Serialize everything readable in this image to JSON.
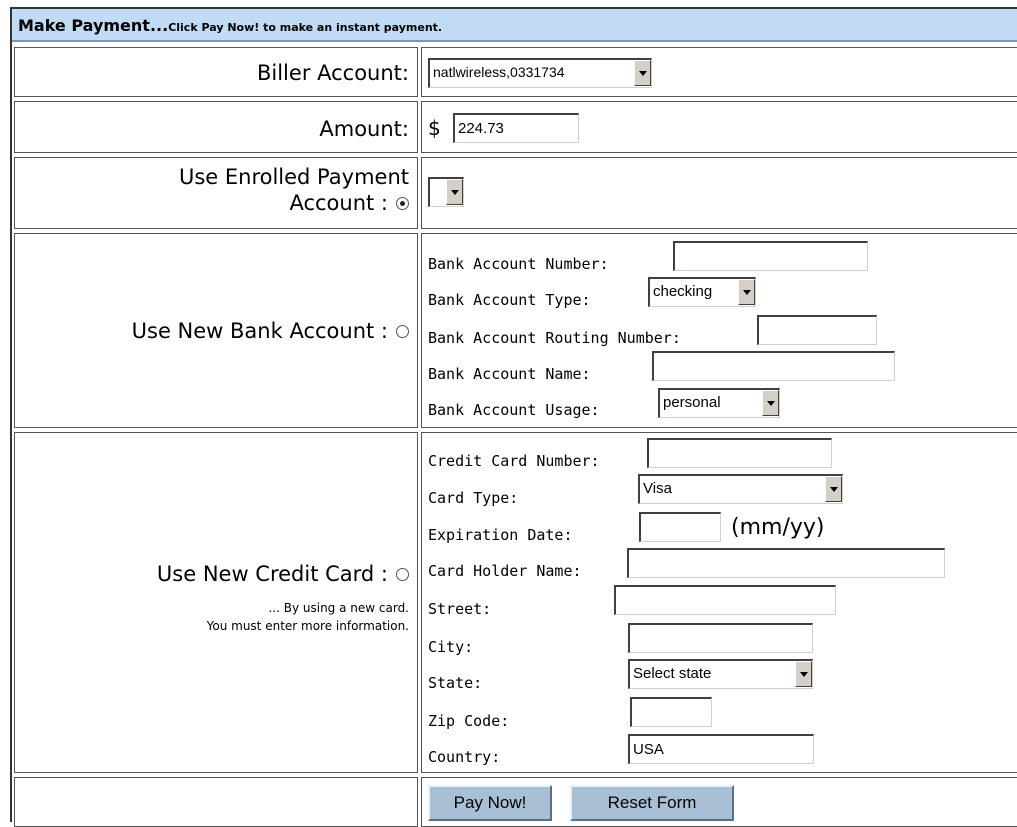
{
  "header": {
    "title": "Make Payment...",
    "subtitle": "Click Pay Now! to make an instant payment."
  },
  "biller": {
    "label": "Biller Account:",
    "value": "natlwireless,0331734"
  },
  "amount": {
    "label": "Amount:",
    "currency": "$",
    "value": "224.73"
  },
  "enrolled": {
    "label_line1": "Use Enrolled Payment",
    "label_line2": "Account :",
    "selected": true,
    "value": ""
  },
  "bank": {
    "label": "Use New Bank Account :",
    "selected": false,
    "account_number_label": "Bank Account Number:",
    "account_number": "",
    "account_type_label": "Bank Account Type:",
    "account_type": "checking",
    "routing_label": "Bank Account Routing Number:",
    "routing": "",
    "name_label": "Bank Account Name:",
    "name": "",
    "usage_label": "Bank Account Usage:",
    "usage": "personal"
  },
  "card": {
    "label": "Use New Credit Card :",
    "selected": false,
    "note_line1": "... By using a new card.",
    "note_line2": "You must enter more information.",
    "number_label": "Credit Card Number:",
    "number": "",
    "type_label": "Card Type:",
    "type": "Visa",
    "expiration_label": "Expiration Date:",
    "expiration": "",
    "expiration_hint": "(mm/yy)",
    "holder_label": "Card Holder Name:",
    "holder": "",
    "street_label": "Street:",
    "street": "",
    "city_label": "City:",
    "city": "",
    "state_label": "State:",
    "state": "Select state",
    "zip_label": "Zip Code:",
    "zip": "",
    "country_label": "Country:",
    "country": "USA"
  },
  "actions": {
    "pay_label": "Pay Now!",
    "reset_label": "Reset Form"
  },
  "colors": {
    "header_bg": "#c2dbf5",
    "button_bg": "#a9bfd6"
  }
}
